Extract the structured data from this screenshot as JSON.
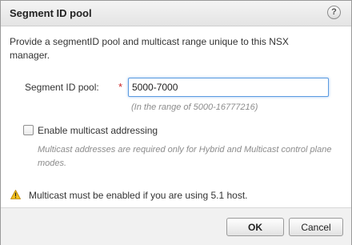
{
  "dialog": {
    "title": "Segment ID pool",
    "help_label": "?"
  },
  "intro_text": "Provide a segmentID pool and multicast range unique to this NSX manager.",
  "segment": {
    "label": "Segment ID pool:",
    "required_marker": "*",
    "value": "5000-7000",
    "hint": "(In the range of 5000-16777216)"
  },
  "multicast": {
    "checkbox_label": "Enable multicast addressing",
    "checked": false,
    "note": "Multicast addresses are required only for Hybrid and Multicast control plane modes."
  },
  "warning": {
    "icon": "warning-icon",
    "text": "Multicast must be enabled if you are using 5.1 host."
  },
  "buttons": {
    "ok": "OK",
    "cancel": "Cancel"
  },
  "colors": {
    "required": "#cc2222",
    "input_focus": "#5c9be0",
    "warning": "#f3c01a"
  }
}
